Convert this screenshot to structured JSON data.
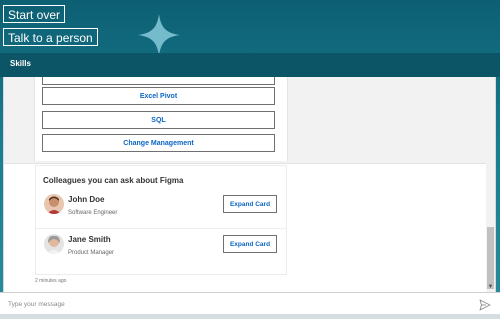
{
  "top_actions": {
    "start_over": "Start over",
    "talk_to_person": "Talk to a person"
  },
  "header": {
    "title": "Skills"
  },
  "skills": {
    "buttons": [
      "Excel Pivot",
      "SQL",
      "Change Management"
    ]
  },
  "colleagues": {
    "title": "Colleagues you can ask about Figma",
    "people": [
      {
        "name": "John Doe",
        "role": "Software Engineer",
        "action": "Expand Card"
      },
      {
        "name": "Jane Smith",
        "role": "Product Manager",
        "action": "Expand Card"
      }
    ]
  },
  "timestamp": "2 minutes ago",
  "composer": {
    "placeholder": "Type your message"
  },
  "colors": {
    "accent": "#0a66c2",
    "header": "#0b5566"
  }
}
